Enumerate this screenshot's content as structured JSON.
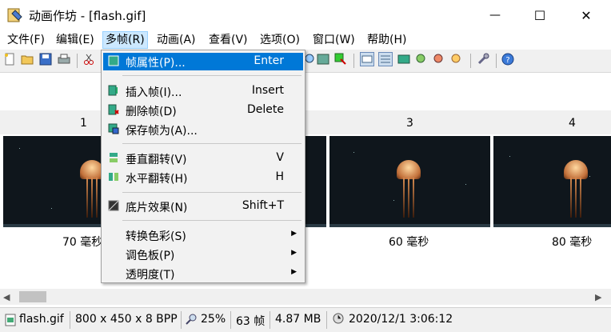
{
  "window": {
    "title": "动画作坊 - [flash.gif]",
    "minimize_glyph": "—",
    "maximize_glyph": "☐",
    "close_glyph": "✕"
  },
  "menubar": [
    {
      "label": "文件(F)"
    },
    {
      "label": "编辑(E)"
    },
    {
      "label": "多帧(R)"
    },
    {
      "label": "动画(A)"
    },
    {
      "label": "查看(V)"
    },
    {
      "label": "选项(O)"
    },
    {
      "label": "窗口(W)"
    },
    {
      "label": "帮助(H)"
    }
  ],
  "dropdown": {
    "items": [
      {
        "label": "帧属性(P)...",
        "shortcut": "Enter",
        "icon": "frame-properties-icon"
      },
      {
        "label": "插入帧(I)...",
        "shortcut": "Insert",
        "icon": "insert-frame-icon"
      },
      {
        "label": "删除帧(D)",
        "shortcut": "Delete",
        "icon": "delete-frame-icon"
      },
      {
        "label": "保存帧为(A)...",
        "shortcut": "",
        "icon": "save-frame-icon"
      },
      {
        "label": "垂直翻转(V)",
        "shortcut": "V",
        "icon": "flip-vertical-icon"
      },
      {
        "label": "水平翻转(H)",
        "shortcut": "H",
        "icon": "flip-horizontal-icon"
      },
      {
        "label": "底片效果(N)",
        "shortcut": "Shift+T",
        "icon": "negative-icon"
      },
      {
        "label": "转换色彩(S)",
        "shortcut": "",
        "submenu": true
      },
      {
        "label": "调色板(P)",
        "shortcut": "",
        "submenu": true
      },
      {
        "label": "透明度(T)",
        "shortcut": "",
        "submenu": true
      }
    ]
  },
  "frames": {
    "numbers": [
      "1",
      "3",
      "4"
    ],
    "delays": [
      "70 毫秒",
      "60 毫秒",
      "80 毫秒"
    ]
  },
  "statusbar": {
    "filename": "flash.gif",
    "dimensions": "800 x 450 x 8 BPP",
    "zoom": "25%",
    "frame_count": "63 帧",
    "file_size": "4.87 MB",
    "date": "2020/12/1 3:06:12"
  },
  "colors": {
    "accent": "#0078d7",
    "menu_active": "#cce8ff"
  }
}
